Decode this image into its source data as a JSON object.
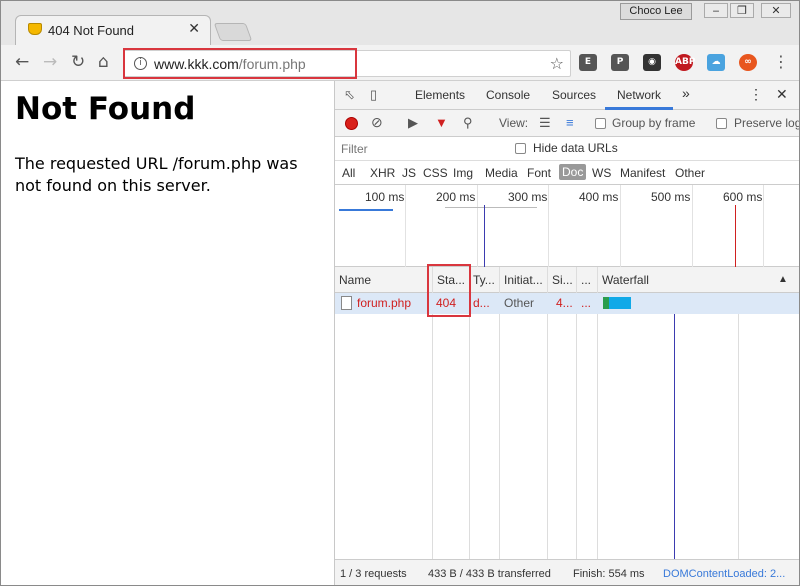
{
  "browser": {
    "tab_title": "404 Not Found",
    "tab_close": "✕",
    "user_name": "Choco Lee",
    "window_buttons": [
      "‒",
      "❐",
      "✕"
    ],
    "address": {
      "domain": "www.kkk.com",
      "path": "/forum.php"
    }
  },
  "page": {
    "heading": "Not Found",
    "message": "The requested URL /forum.php was not found on this server."
  },
  "devtools": {
    "tabs": [
      "Elements",
      "Console",
      "Sources",
      "Network"
    ],
    "more": "»",
    "active_tab": "Network",
    "toolbar": {
      "view_label": "View:",
      "group_by_frame": "Group by frame",
      "preserve_log": "Preserve log"
    },
    "filter": {
      "placeholder": "Filter",
      "hide_data_urls": "Hide data URLs"
    },
    "type_filters": [
      "All",
      "XHR",
      "JS",
      "CSS",
      "Img",
      "Media",
      "Font",
      "Doc",
      "WS",
      "Manifest",
      "Other"
    ],
    "selected_type": "Doc",
    "timeline_ticks": [
      "100 ms",
      "200 ms",
      "300 ms",
      "400 ms",
      "500 ms",
      "600 ms"
    ],
    "columns": [
      "Name",
      "Sta...",
      "Ty...",
      "Initiat...",
      "Si...",
      "...",
      "Waterfall"
    ],
    "row": {
      "name": "forum.php",
      "status": "404",
      "type": "d...",
      "initiator": "Other",
      "size": "4...",
      "time": "..."
    },
    "statusbar": {
      "requests": "1 / 3 requests",
      "transferred": "433 B / 433 B transferred",
      "finish": "Finish: 554 ms",
      "domcontent": "DOMContentLoaded: 2..."
    },
    "colors": {
      "error": "#d02020",
      "accent": "#3879d9",
      "highlight_box": "#d9363e"
    }
  }
}
